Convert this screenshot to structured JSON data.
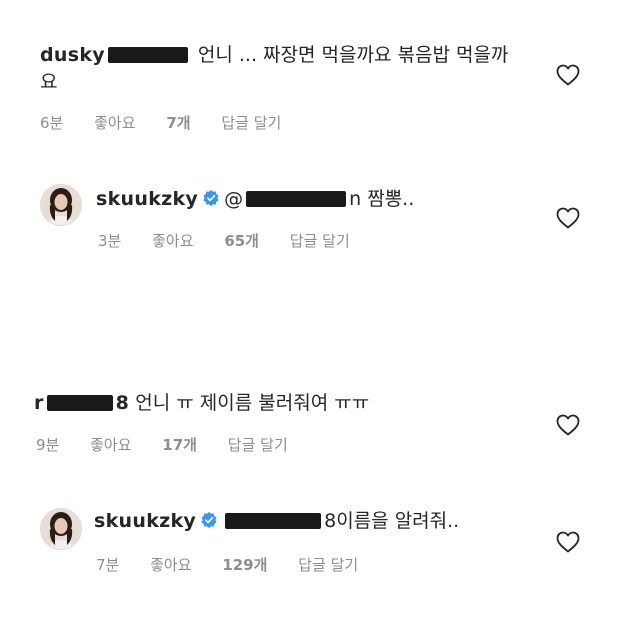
{
  "comments": [
    {
      "username": "dusky",
      "text": "언니 ... 짜장면 먹을까요 볶음밥 먹을까요",
      "time": "6분",
      "likes_label": "좋아요",
      "likes_count": "7개",
      "reply": "답글 달기",
      "heart_icon": "heart-outline-icon"
    },
    {
      "username": "skuukzky",
      "mention_prefix": "@",
      "mention_suffix": "n",
      "text": "짬뽕..",
      "time": "3분",
      "likes_label": "좋아요",
      "likes_count": "65개",
      "reply": "답글 달기",
      "heart_icon": "heart-outline-icon",
      "verified": true
    },
    {
      "username": "r",
      "username_suffix": "8",
      "text": "언니 ㅠ 제이름 불러줘여 ㅠㅠ",
      "time": "9분",
      "likes_label": "좋아요",
      "likes_count": "17개",
      "reply": "답글 달기",
      "heart_icon": "heart-outline-icon"
    },
    {
      "username": "skuukzky",
      "mention_suffix": "8",
      "text": "이름을 알려줘..",
      "time": "7분",
      "likes_label": "좋아요",
      "likes_count": "129개",
      "reply": "답글 달기",
      "heart_icon": "heart-outline-icon",
      "verified": true
    }
  ],
  "colors": {
    "text": "#262626",
    "meta": "#8e8e8e",
    "verified": "#3897f0",
    "redaction": "#1a1a1a"
  }
}
